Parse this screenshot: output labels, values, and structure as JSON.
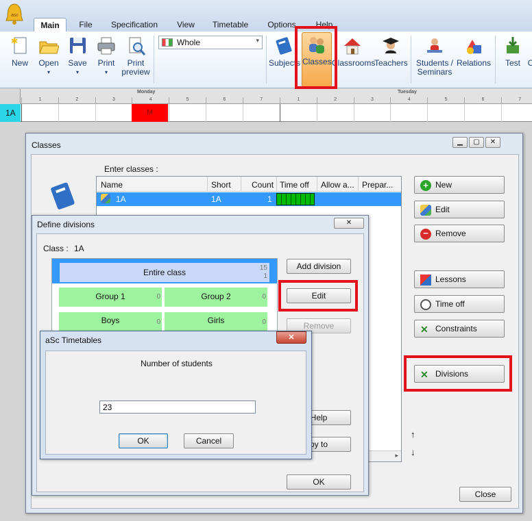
{
  "ribbon": {
    "tabs": [
      "Main",
      "File",
      "Specification",
      "View",
      "Timetable",
      "Options",
      "Help"
    ],
    "buttons": {
      "new": "New",
      "open": "Open",
      "save": "Save",
      "print": "Print",
      "print_preview": "Print preview",
      "subjects": "Subjects",
      "classes": "Classes",
      "classrooms": "Classrooms",
      "teachers": "Teachers",
      "students": "Students / Seminars",
      "relations": "Relations",
      "test": "Test",
      "c_cut": "C"
    },
    "view_select": "Whole"
  },
  "grid": {
    "row_label": "1A",
    "day1": "Monday",
    "day2": "Tuesday",
    "periods": [
      "1",
      "2",
      "3",
      "4",
      "5",
      "6",
      "7"
    ],
    "cell": "M"
  },
  "classes_win": {
    "title": "Classes",
    "enter_label": "Enter classes :",
    "columns": [
      "Name",
      "Short",
      "Count",
      "Time off",
      "Allow a...",
      "Prepar..."
    ],
    "row": {
      "name": "1A",
      "short": "1A",
      "count": "1"
    },
    "buttons": {
      "new": "New",
      "edit": "Edit",
      "remove": "Remove",
      "lessons": "Lessons",
      "time_off": "Time off",
      "constraints": "Constraints",
      "divisions": "Divisions",
      "close": "Close"
    },
    "arrows": {
      "up": "↑",
      "down": "↓"
    }
  },
  "divisions_win": {
    "title": "Define divisions",
    "class_label": "Class :",
    "class_value": "1A",
    "entire": "Entire class",
    "entire_num1": "15",
    "entire_num2": "1",
    "groups": [
      {
        "label": "Group 1",
        "n": "0"
      },
      {
        "label": "Group 2",
        "n": "0"
      },
      {
        "label": "Boys",
        "n": "0"
      },
      {
        "label": "Girls",
        "n": "0"
      }
    ],
    "buttons": {
      "add": "Add division",
      "edit": "Edit",
      "remove": "Remove",
      "help": "Help",
      "copy": "py to",
      "ok": "OK"
    }
  },
  "asc_dialog": {
    "title": "aSc Timetables",
    "prompt": "Number of students",
    "value": "23",
    "ok": "OK",
    "cancel": "Cancel"
  },
  "colors": {
    "highlight": "#e3111b",
    "selected_row": "#3399ff",
    "green_cell": "#9ef39e",
    "red_cell": "#ff0000"
  }
}
